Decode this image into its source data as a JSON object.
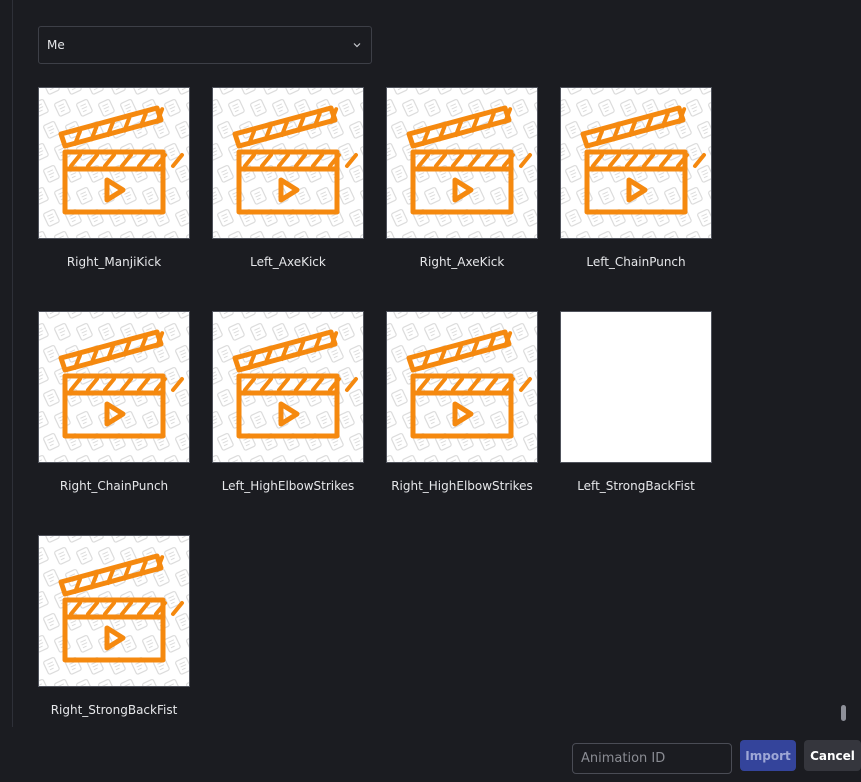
{
  "creator_select": {
    "value": "Me",
    "icon": "chevron-down-icon"
  },
  "thumbnail_icon": "clapperboard-icon",
  "thumbnail_color": "#f5890f",
  "animations": [
    {
      "label": "Right_ManjiKick",
      "has_thumbnail": true
    },
    {
      "label": "Left_AxeKick",
      "has_thumbnail": true
    },
    {
      "label": "Right_AxeKick",
      "has_thumbnail": true
    },
    {
      "label": "Left_ChainPunch",
      "has_thumbnail": true
    },
    {
      "label": "Right_ChainPunch",
      "has_thumbnail": true
    },
    {
      "label": "Left_HighElbowStrikes",
      "has_thumbnail": true
    },
    {
      "label": "Right_HighElbowStrikes",
      "has_thumbnail": true
    },
    {
      "label": "Left_StrongBackFist",
      "has_thumbnail": false
    },
    {
      "label": "Right_StrongBackFist",
      "has_thumbnail": true
    }
  ],
  "footer": {
    "animation_id_placeholder": "Animation ID",
    "import_label": "Import",
    "cancel_label": "Cancel"
  },
  "colors": {
    "background": "#1b1c21",
    "import_button": "#34449b",
    "cancel_button": "#35363d"
  }
}
